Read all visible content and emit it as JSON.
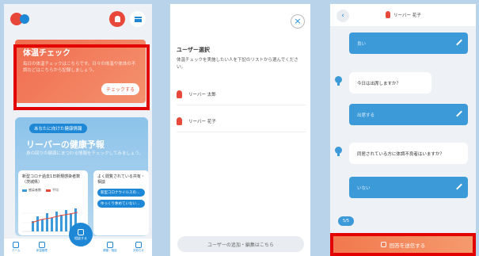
{
  "colors": {
    "brand_red": "#e8483a",
    "brand_blue": "#1e88d6",
    "highlight_frame": "#e30000",
    "answer_bubble": "#3d9ad8"
  },
  "screen1": {
    "icons": [
      "logo",
      "bell-icon",
      "menu-icon"
    ],
    "health_check": {
      "title": "体温チェック",
      "description": "毎日の体温チェックはこちらです。日々の体温や体体の不調などはこちらから記録しましょう。",
      "button": "チェックする"
    },
    "forecast": {
      "tag": "あなたに向けた健康情報",
      "title": "リーバーの健康予報",
      "subtitle": "身の回りの健康にまつわる情報をチェックしてみましょう。",
      "chart_card": {
        "title": "新型コロナ過去1日新規感染者数（茨城県）",
        "legend": [
          "感染者数",
          "平均"
        ]
      },
      "read_card": {
        "title": "よく閲覧されている共有・相談",
        "items": [
          "新型コロナウイルスの…",
          "ゆっくり休めていない…"
        ]
      }
    },
    "nav": {
      "items": [
        {
          "label": "ホーム"
        },
        {
          "label": "体温管理"
        },
        {
          "label": "相談する"
        },
        {
          "label": "健康・相談"
        },
        {
          "label": "お知らせ"
        }
      ]
    }
  },
  "screen2": {
    "close_label": "×",
    "title": "ユーザー選択",
    "description": "体温チェックを実施したい人を下記のリストから選んでください。",
    "users": [
      "リーバー 太郎",
      "リーバー 花子"
    ],
    "bottom_button": "ユーザーの追加・編集はこちら"
  },
  "screen3": {
    "back_label": "‹",
    "header_user": "リーバー 花子",
    "answers": [
      "良い",
      "出席する",
      "いない"
    ],
    "questions": [
      "今日は出席しますか？",
      "同居されている方に体調不良者はいますか？"
    ],
    "progress": "5/5",
    "submit": "回答を送信する"
  }
}
